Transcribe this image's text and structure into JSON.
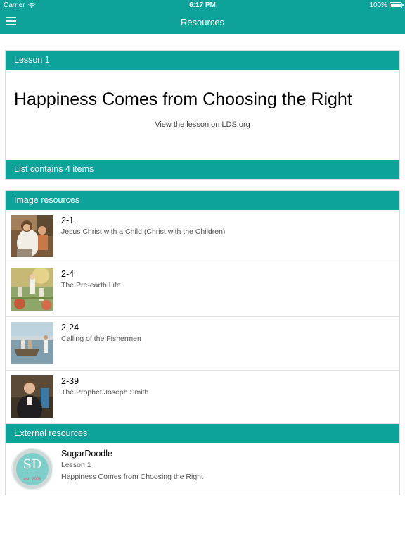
{
  "status_bar": {
    "carrier": "Carrier",
    "time": "6:17 PM",
    "battery": "100%"
  },
  "nav": {
    "title": "Resources",
    "menu_icon": "hamburger-icon"
  },
  "lesson": {
    "header": "Lesson 1",
    "title": "Happiness Comes from Choosing the Right",
    "link": "View the lesson on LDS.org",
    "list_count": "List contains 4 items"
  },
  "image_resources": {
    "header": "Image resources",
    "items": [
      {
        "code": "2-1",
        "desc": "Jesus Christ with a Child (Christ with the Children)"
      },
      {
        "code": "2-4",
        "desc": "The Pre-earth Life"
      },
      {
        "code": "2-24",
        "desc": "Calling of the Fishermen"
      },
      {
        "code": "2-39",
        "desc": "The Prophet Joseph Smith"
      }
    ]
  },
  "external_resources": {
    "header": "External resources",
    "items": [
      {
        "name": "SugarDoodle",
        "sub1": "Lesson 1",
        "sub2": "Happiness Comes from Choosing the Right",
        "logo_text": "SD",
        "logo_sub": "est. 2003"
      }
    ]
  },
  "colors": {
    "accent": "#0ea39a"
  }
}
